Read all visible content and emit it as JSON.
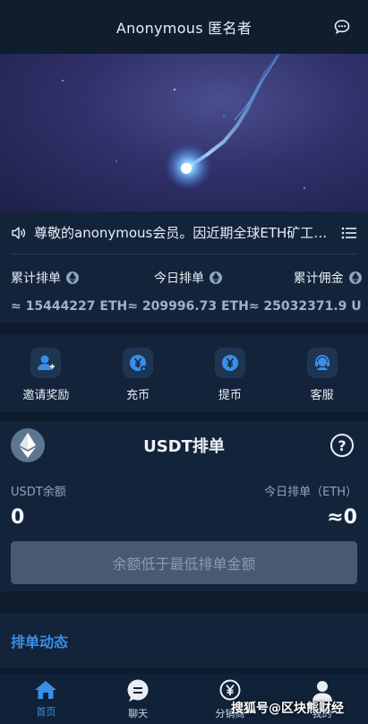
{
  "header": {
    "title": "Anonymous 匿名者"
  },
  "notice": {
    "text": "尊敬的anonymous会员。因近期全球ETH矿工数量大幅增加"
  },
  "stats": [
    {
      "label": "累计排单",
      "value": "≈ 15444227 ETH"
    },
    {
      "label": "今日排单",
      "value": "≈ 209996.73 ETH"
    },
    {
      "label": "累计佣金",
      "value": "≈ 25032371.9 U"
    }
  ],
  "actions": [
    {
      "label": "邀请奖励",
      "icon": "user-plus-icon"
    },
    {
      "label": "充币",
      "icon": "yen-deposit-icon"
    },
    {
      "label": "提币",
      "icon": "yen-withdraw-icon"
    },
    {
      "label": "客服",
      "icon": "headset-icon"
    }
  ],
  "usdt": {
    "title": "USDT排单",
    "balance_label": "USDT余额",
    "today_label": "今日排单（ETH）",
    "balance_value": "0",
    "today_value": "≈0",
    "button_label": "余额低于最低排单金额"
  },
  "dynamic": {
    "title": "排单动态"
  },
  "tabs": [
    {
      "label": "首页",
      "active": true
    },
    {
      "label": "聊天",
      "active": false
    },
    {
      "label": "分销商",
      "active": false
    },
    {
      "label": "我的",
      "active": false
    }
  ],
  "watermark": "搜狐号@区块熊财经",
  "colors": {
    "accent": "#3a8ee8",
    "background": "#0d1b2c",
    "card": "#13243a"
  }
}
